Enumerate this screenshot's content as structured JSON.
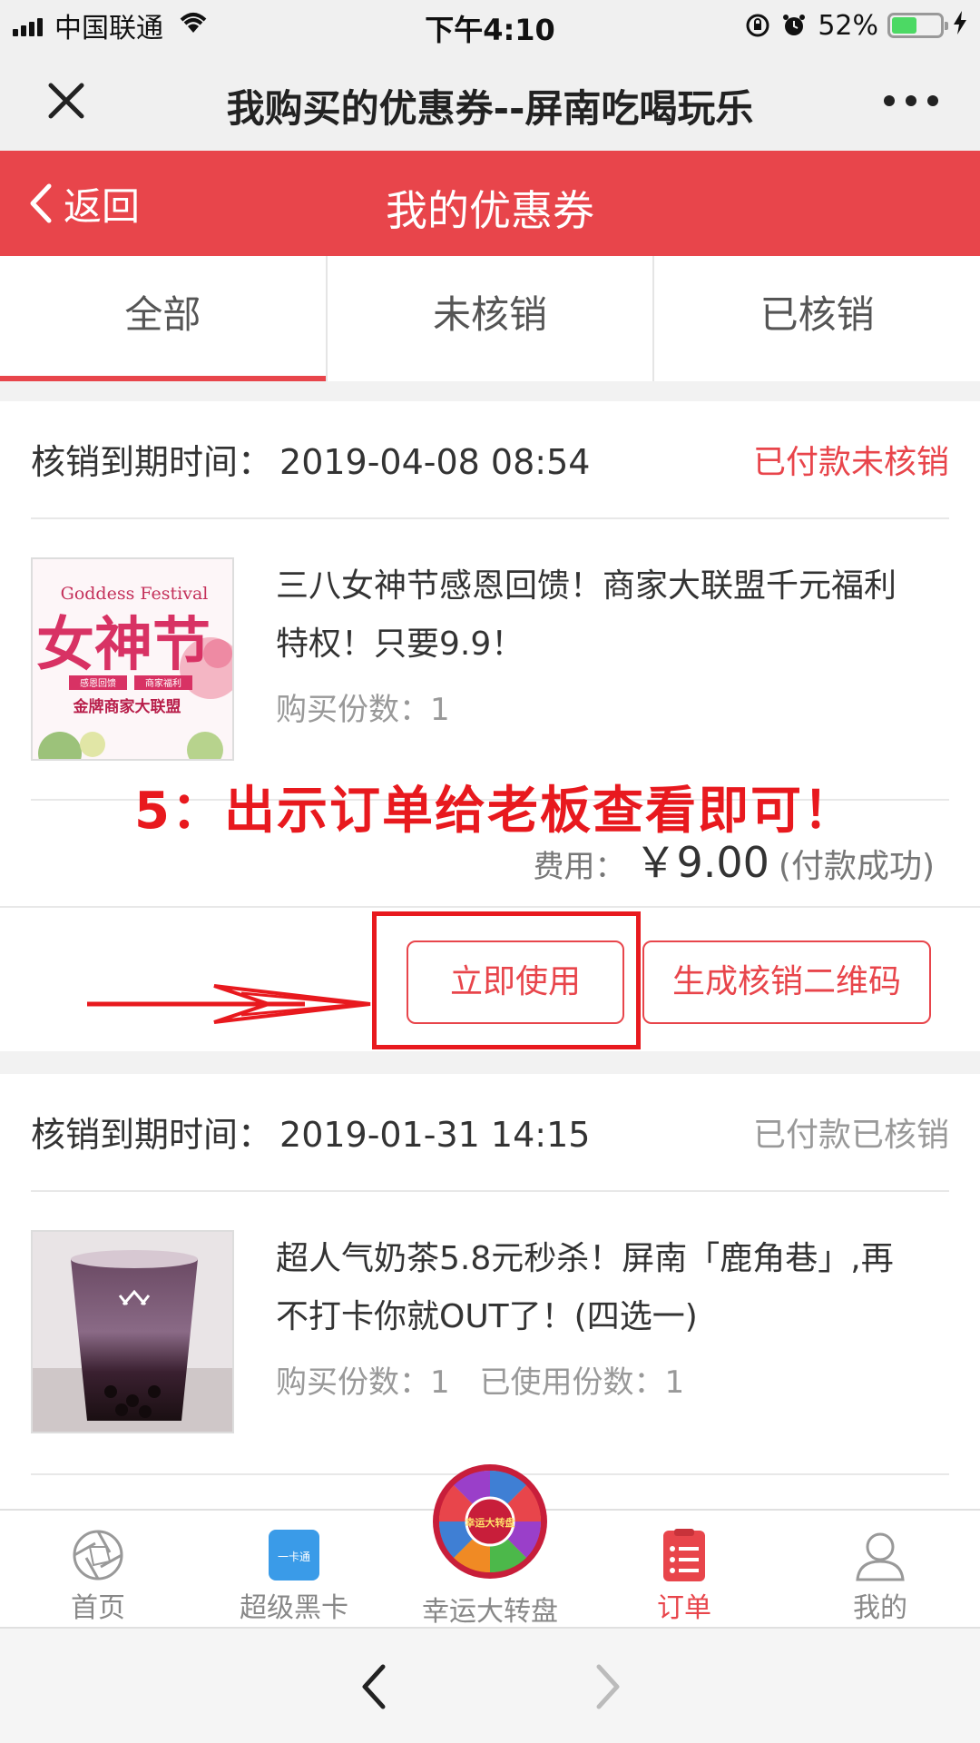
{
  "status_bar": {
    "carrier": "中国联通",
    "time": "下午4:10",
    "battery_percent": "52%",
    "battery_level": 0.52,
    "battery_color": "#4cd964"
  },
  "titlebar": {
    "title": "我购买的优惠券--屏南吃喝玩乐"
  },
  "header": {
    "back_label": "返回",
    "title": "我的优惠券",
    "color": "#e8454b"
  },
  "tabs": [
    {
      "label": "全部",
      "active": true
    },
    {
      "label": "未核销",
      "active": false
    },
    {
      "label": "已核销",
      "active": false
    }
  ],
  "orders": [
    {
      "expire_label": "核销到期时间：",
      "expire_value": "2019-04-08 08:54",
      "status": "已付款未核销",
      "title": "三八女神节感恩回馈！商家大联盟千元福利特权！只要9.9！",
      "image": {
        "text_en": "Goddess Festival",
        "text_cn": "女神节",
        "tag1": "感恩回馈",
        "tag2": "商家福利",
        "sub": "金牌商家大联盟"
      },
      "quantity": "购买份数：1",
      "fee_label": "费用：",
      "fee_amount": "￥9.00",
      "fee_note": "(付款成功)",
      "buttons": {
        "use": "立即使用",
        "qr": "生成核销二维码"
      }
    },
    {
      "expire_label": "核销到期时间：",
      "expire_value": "2019-01-31 14:15",
      "status": "已付款已核销",
      "title": "超人气奶茶5.8元秒杀！屏南「鹿角巷」,再不打卡你就OUT了！(四选一)",
      "quantity": "购买份数：1",
      "used": "已使用份数：1"
    }
  ],
  "annotation": {
    "text": "5：出示订单给老板查看即可！",
    "color": "#e8191e"
  },
  "bottom_nav": [
    {
      "label": "首页",
      "icon": "camera-lens-icon",
      "active": false
    },
    {
      "label": "超级黑卡",
      "icon": "card-icon",
      "active": false,
      "icon_text": "一卡通"
    },
    {
      "label": "幸运大转盘",
      "icon": "wheel-icon",
      "active": false,
      "icon_text": "幸运大转盘"
    },
    {
      "label": "订单",
      "icon": "order-list-icon",
      "active": true
    },
    {
      "label": "我的",
      "icon": "user-icon",
      "active": false
    }
  ]
}
